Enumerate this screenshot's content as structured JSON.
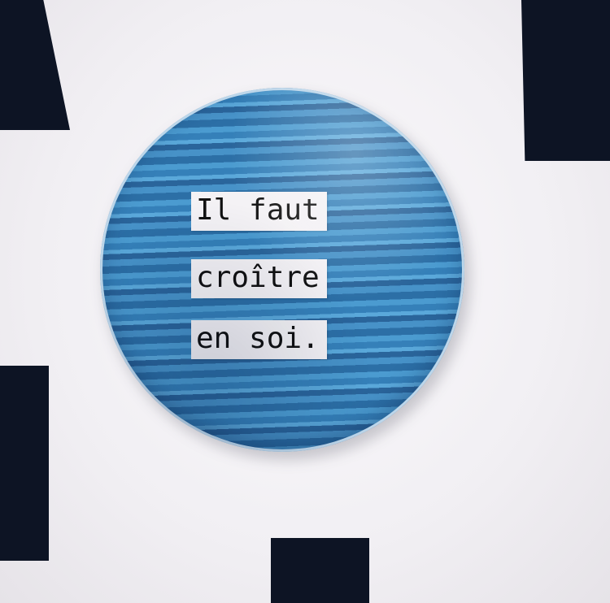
{
  "badge": {
    "lines": [
      "Il faut",
      "croître",
      "en soi."
    ],
    "colors": {
      "stripe_dark": "#2c6fa6",
      "stripe_light": "#5aa8da",
      "label_bg": "#f4f2f5",
      "text": "#111111"
    }
  },
  "background": {
    "paper_color": "#f3f1f4",
    "block_color": "#0d1424"
  }
}
